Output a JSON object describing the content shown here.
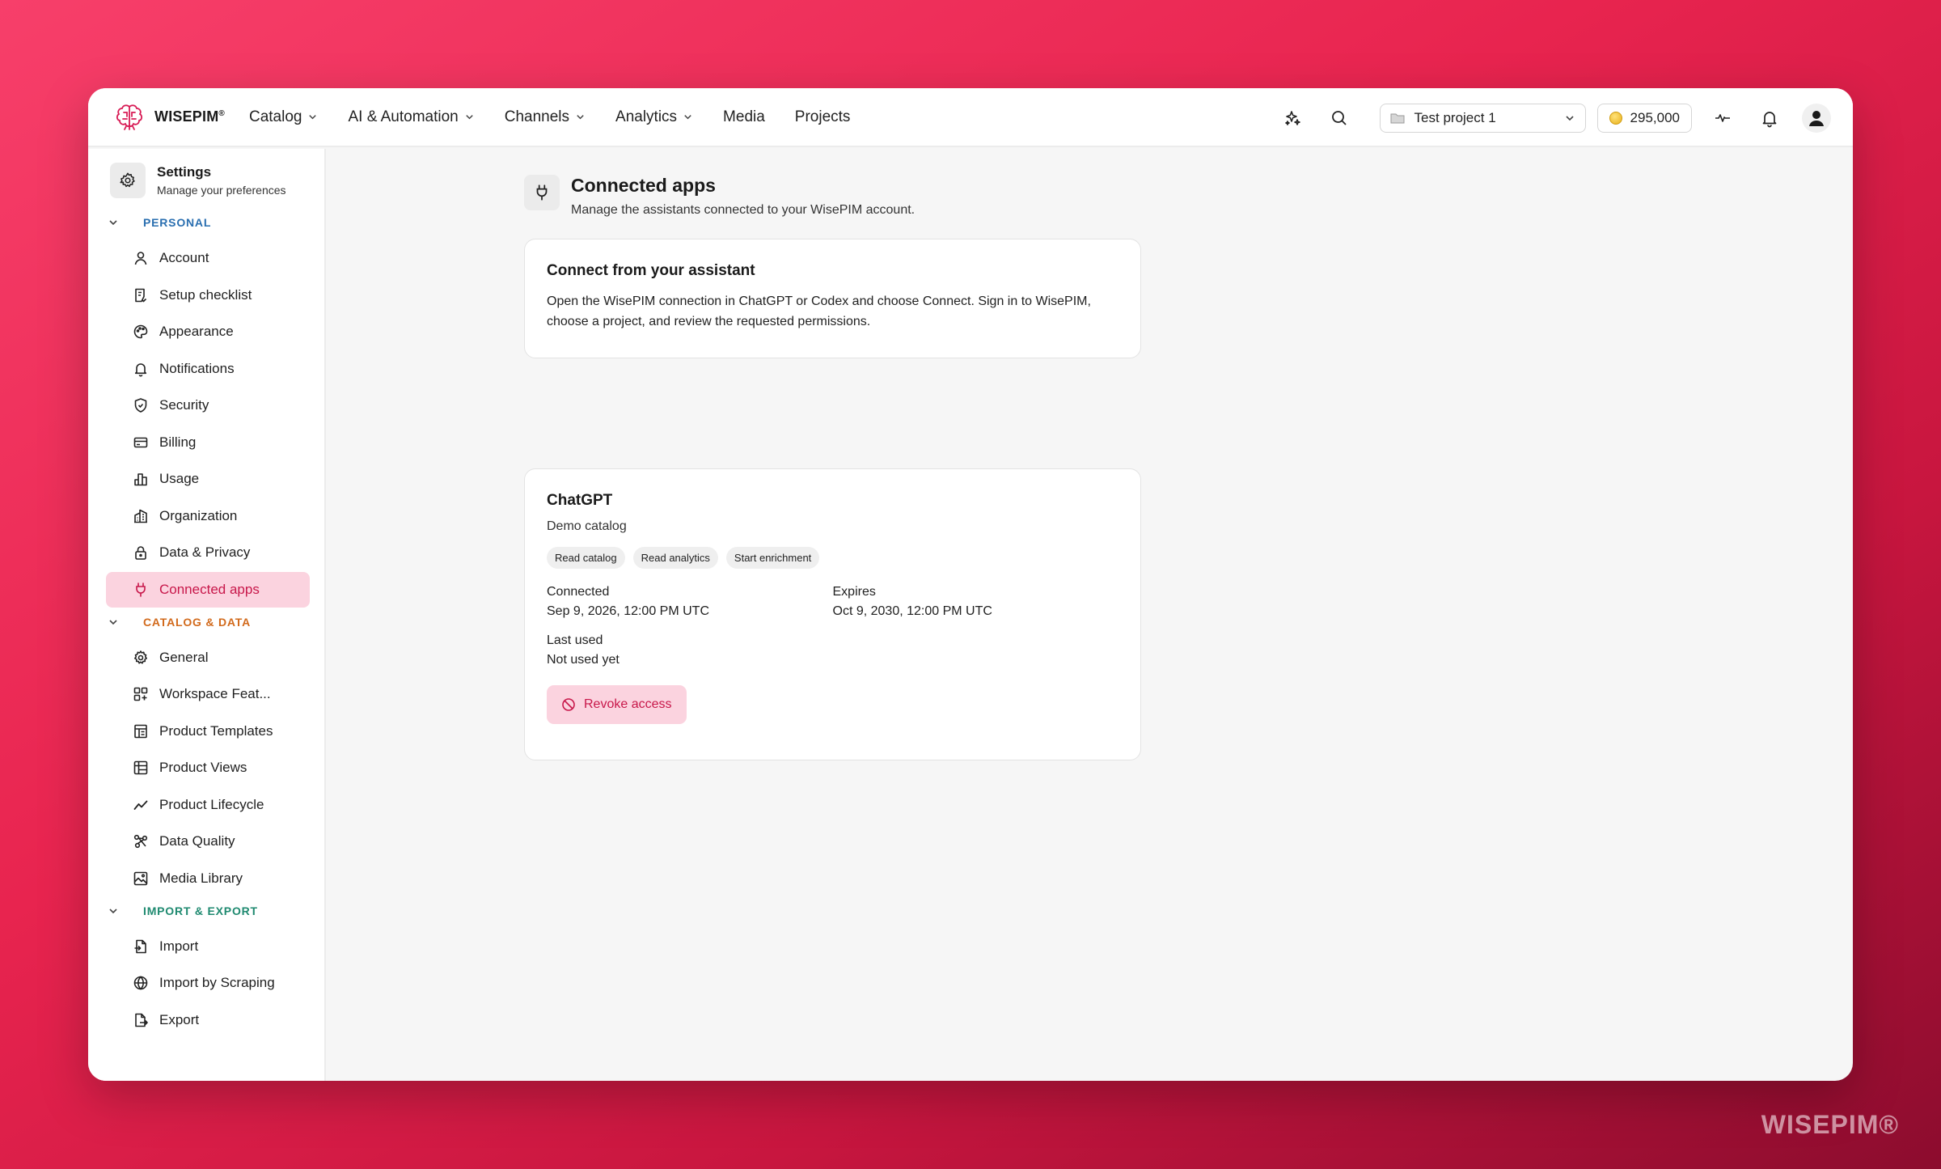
{
  "brand": {
    "name": "WISEPIM",
    "mark": "®"
  },
  "nav": [
    {
      "label": "Catalog",
      "dropdown": true
    },
    {
      "label": "AI & Automation",
      "dropdown": true
    },
    {
      "label": "Channels",
      "dropdown": true
    },
    {
      "label": "Analytics",
      "dropdown": true
    },
    {
      "label": "Media",
      "dropdown": false
    },
    {
      "label": "Projects",
      "dropdown": false
    }
  ],
  "project": {
    "selected": "Test project 1"
  },
  "credits": {
    "value": "295,000"
  },
  "sidebar": {
    "title": "Settings",
    "subtitle": "Manage your preferences",
    "sections": [
      {
        "label": "PERSONAL",
        "color": "#2a6fb0",
        "items": [
          "Account",
          "Setup checklist",
          "Appearance",
          "Notifications",
          "Security",
          "Billing",
          "Usage",
          "Organization",
          "Data & Privacy",
          "Connected apps"
        ]
      },
      {
        "label": "CATALOG & DATA",
        "color": "#d26a1c",
        "items": [
          "General",
          "Workspace Feat...",
          "Product Templates",
          "Product Views",
          "Product Lifecycle",
          "Data Quality",
          "Media Library"
        ]
      },
      {
        "label": "IMPORT & EXPORT",
        "color": "#1f8a70",
        "items": [
          "Import",
          "Import by Scraping",
          "Export"
        ]
      }
    ],
    "active_item": "Connected apps"
  },
  "page": {
    "title": "Connected apps",
    "subtitle": "Manage the assistants connected to your WisePIM account."
  },
  "connect_card": {
    "title": "Connect from your assistant",
    "text": "Open the WisePIM connection in ChatGPT or Codex and choose Connect. Sign in to WisePIM, choose a project, and review the requested permissions."
  },
  "app_card": {
    "name": "ChatGPT",
    "project": "Demo catalog",
    "permissions": [
      "Read catalog",
      "Read analytics",
      "Start enrichment"
    ],
    "connected_label": "Connected",
    "connected_value": "Sep 9, 2026, 12:00 PM UTC",
    "expires_label": "Expires",
    "expires_value": "Oct 9, 2030, 12:00 PM UTC",
    "last_used_label": "Last used",
    "last_used_value": "Not used yet",
    "revoke_label": "Revoke access"
  },
  "watermark": "WISEPIM®",
  "colors": {
    "accent": "#c8174a",
    "active_bg": "#fbd3df"
  }
}
